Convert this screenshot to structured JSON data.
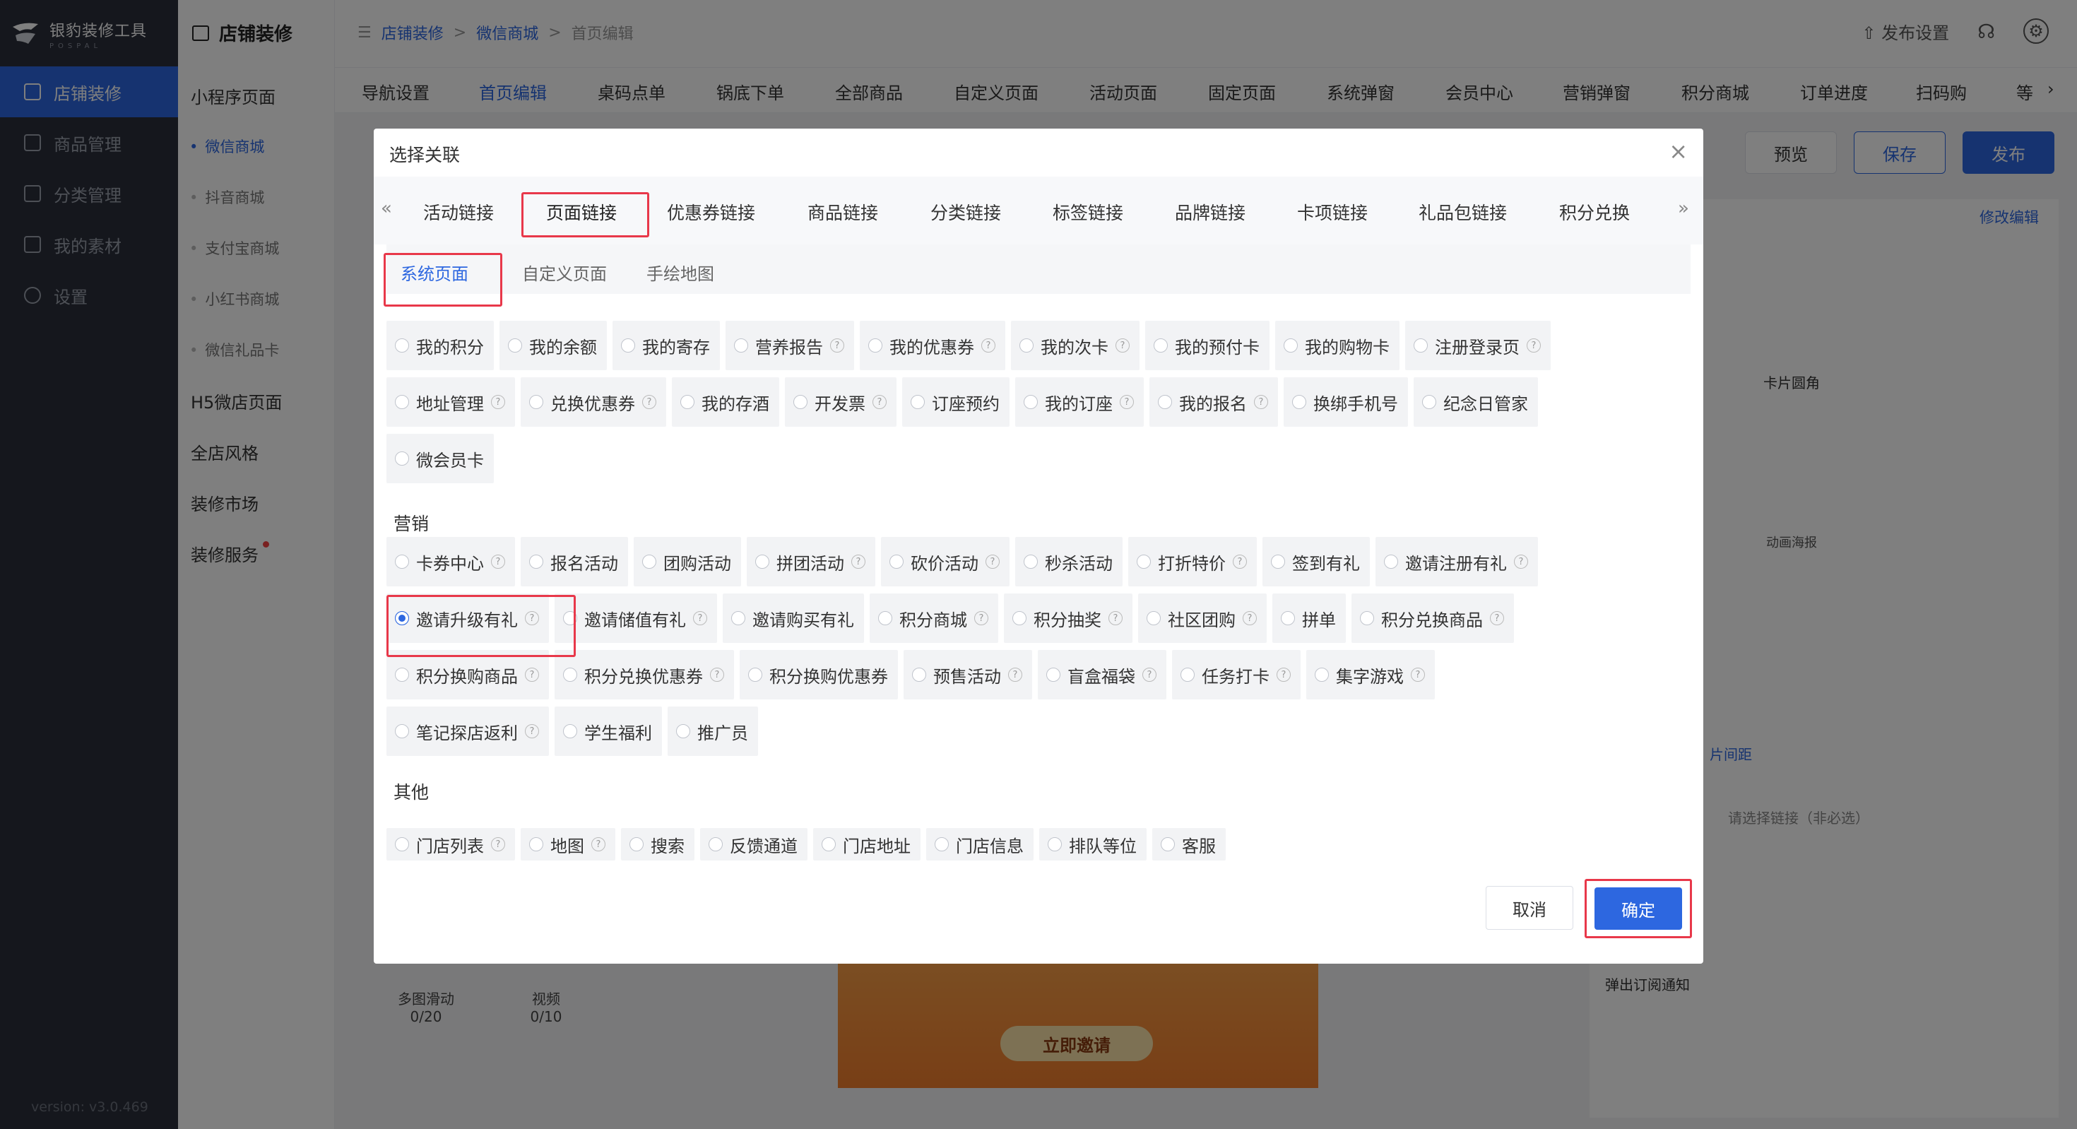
{
  "app": {
    "logo_title": "银豹装修工具",
    "logo_sub": "POSPAL",
    "version": "version: v3.0.469"
  },
  "sidebar": {
    "items": [
      {
        "label": "店铺装修",
        "icon": "store-icon"
      },
      {
        "label": "商品管理",
        "icon": "grid-icon"
      },
      {
        "label": "分类管理",
        "icon": "list-icon"
      },
      {
        "label": "我的素材",
        "icon": "image-icon"
      },
      {
        "label": "设置",
        "icon": "gear-icon"
      }
    ]
  },
  "sidebar2": {
    "header": "店铺装修",
    "mini_program": "小程序页面",
    "subs": [
      "微信商城",
      "抖音商城",
      "支付宝商城",
      "小红书商城",
      "微信礼品卡"
    ],
    "h5": "H5微店页面",
    "style": "全店风格",
    "market": "装修市场",
    "service": "装修服务"
  },
  "breadcrumb": [
    "店铺装修",
    "微信商城",
    "首页编辑"
  ],
  "topbar": {
    "publish_settings": "发布设置"
  },
  "nav_tabs": [
    "导航设置",
    "首页编辑",
    "桌码点单",
    "锅底下单",
    "全部商品",
    "自定义页面",
    "活动页面",
    "固定页面",
    "系统弹窗",
    "会员中心",
    "营销弹窗",
    "积分商城",
    "订单进度",
    "扫码购",
    "等"
  ],
  "actions": {
    "preview": "预览",
    "save": "保存",
    "publish": "发布"
  },
  "background": {
    "invite_button": "立即邀请",
    "tool_multi": "多图滑动",
    "tool_multi_count": "0/20",
    "tool_video": "视频",
    "tool_video_count": "0/10",
    "panel_edit": "修改编辑",
    "panel_round": "卡片圆角",
    "panel_poster": "动画海报",
    "panel_link_placeholder": "请选择链接（非必选）",
    "panel_subscribe": "弹出订阅通知",
    "panel_spacing": "片间距"
  },
  "modal": {
    "title": "选择关联",
    "close": "×",
    "link_tabs": [
      "活动链接",
      "页面链接",
      "优惠券链接",
      "商品链接",
      "分类链接",
      "标签链接",
      "品牌链接",
      "卡项链接",
      "礼品包链接",
      "积分兑换"
    ],
    "sub_tabs": [
      "系统页面",
      "自定义页面",
      "手绘地图"
    ],
    "rows_system": [
      [
        {
          "t": "我的积分",
          "q": false
        },
        {
          "t": "我的余额",
          "q": false
        },
        {
          "t": "我的寄存",
          "q": false
        },
        {
          "t": "营养报告",
          "q": true
        },
        {
          "t": "我的优惠券",
          "q": true
        },
        {
          "t": "我的次卡",
          "q": true
        },
        {
          "t": "我的预付卡",
          "q": false
        },
        {
          "t": "我的购物卡",
          "q": false
        },
        {
          "t": "注册登录页",
          "q": true
        }
      ],
      [
        {
          "t": "地址管理",
          "q": true
        },
        {
          "t": "兑换优惠券",
          "q": true
        },
        {
          "t": "我的存酒",
          "q": false
        },
        {
          "t": "开发票",
          "q": true
        },
        {
          "t": "订座预约",
          "q": false
        },
        {
          "t": "我的订座",
          "q": true
        },
        {
          "t": "我的报名",
          "q": true
        },
        {
          "t": "换绑手机号",
          "q": false
        },
        {
          "t": "纪念日管家",
          "q": false
        }
      ],
      [
        {
          "t": "微会员卡",
          "q": false
        }
      ]
    ],
    "section_marketing": "营销",
    "rows_marketing": [
      [
        {
          "t": "卡券中心",
          "q": true
        },
        {
          "t": "报名活动",
          "q": false
        },
        {
          "t": "团购活动",
          "q": false
        },
        {
          "t": "拼团活动",
          "q": true
        },
        {
          "t": "砍价活动",
          "q": true
        },
        {
          "t": "秒杀活动",
          "q": false
        },
        {
          "t": "打折特价",
          "q": true
        },
        {
          "t": "签到有礼",
          "q": false
        },
        {
          "t": "邀请注册有礼",
          "q": true
        }
      ],
      [
        {
          "t": "邀请升级有礼",
          "q": true,
          "sel": true
        },
        {
          "t": "邀请储值有礼",
          "q": true
        },
        {
          "t": "邀请购买有礼",
          "q": false
        },
        {
          "t": "积分商城",
          "q": true
        },
        {
          "t": "积分抽奖",
          "q": true
        },
        {
          "t": "社区团购",
          "q": true
        },
        {
          "t": "拼单",
          "q": false
        },
        {
          "t": "积分兑换商品",
          "q": true
        }
      ],
      [
        {
          "t": "积分换购商品",
          "q": true
        },
        {
          "t": "积分兑换优惠券",
          "q": true
        },
        {
          "t": "积分换购优惠券",
          "q": false
        },
        {
          "t": "预售活动",
          "q": true
        },
        {
          "t": "盲盒福袋",
          "q": true
        },
        {
          "t": "任务打卡",
          "q": true
        },
        {
          "t": "集字游戏",
          "q": true
        }
      ],
      [
        {
          "t": "笔记探店返利",
          "q": true
        },
        {
          "t": "学生福利",
          "q": false
        },
        {
          "t": "推广员",
          "q": false
        }
      ]
    ],
    "section_other": "其他",
    "rows_other": [
      [
        {
          "t": "门店列表",
          "q": true
        },
        {
          "t": "地图",
          "q": true
        },
        {
          "t": "搜索",
          "q": false
        },
        {
          "t": "反馈通道",
          "q": false
        },
        {
          "t": "门店地址",
          "q": false
        },
        {
          "t": "门店信息",
          "q": false
        },
        {
          "t": "排队等位",
          "q": false
        },
        {
          "t": "客服",
          "q": false
        }
      ]
    ],
    "cancel": "取消",
    "confirm": "确定"
  },
  "colors": {
    "accent": "#2d67e0",
    "highlight": "#e8384a",
    "sidebar_bg": "#2b2f3a"
  }
}
